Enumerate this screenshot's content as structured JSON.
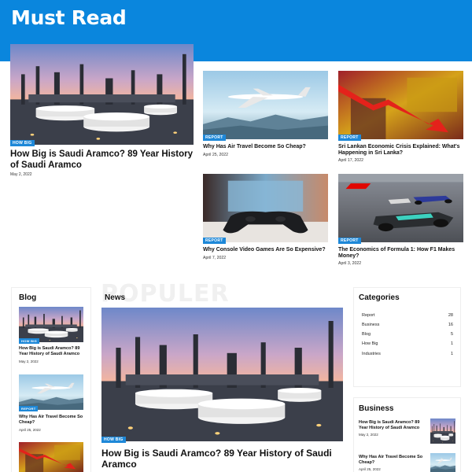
{
  "page_title": "Must Read",
  "featured": {
    "badge": "HOW BIG",
    "title": "How Big is Saudi Aramco? 89 Year History of Saudi Aramco",
    "date": "May 2, 2022"
  },
  "cards": [
    {
      "badge": "REPORT",
      "title": "Why Has Air Travel Become So Cheap?",
      "date": "April 25, 2022"
    },
    {
      "badge": "REPORT",
      "title": "Sri Lankan Economic Crisis Explained: What's Happening in Sri Lanka?",
      "date": "April 17, 2022"
    },
    {
      "badge": "REPORT",
      "title": "Why Console Video Games Are So Expensive?",
      "date": "April 7, 2022"
    },
    {
      "badge": "REPORT",
      "title": "The Economics of Formula 1: How F1 Makes Money?",
      "date": "April 3, 2022"
    }
  ],
  "blog": {
    "heading": "Blog",
    "items": [
      {
        "badge": "HOW BIG",
        "title": "How Big is Saudi Aramco? 89 Year History of Saudi Aramco",
        "date": "May 2, 2022"
      },
      {
        "badge": "REPORT",
        "title": "Why Has Air Travel Become So Cheap?",
        "date": "April 25, 2022"
      }
    ]
  },
  "news": {
    "watermark": "POPULER",
    "heading": "News",
    "badge": "HOW BIG",
    "title": "How Big is Saudi Aramco? 89 Year History of Saudi Aramco"
  },
  "categories": {
    "heading": "Categories",
    "items": [
      {
        "name": "Report",
        "count": "28"
      },
      {
        "name": "Business",
        "count": "16"
      },
      {
        "name": "Blog",
        "count": "5"
      },
      {
        "name": "How Big",
        "count": "1"
      },
      {
        "name": "Industries",
        "count": "1"
      }
    ]
  },
  "business": {
    "heading": "Business",
    "items": [
      {
        "title": "How Big is Saudi Aramco? 89 Year History of Saudi Aramco",
        "date": "May 2, 2022"
      },
      {
        "title": "Why Has Air Travel Become So Cheap?",
        "date": "April 25, 2022"
      }
    ]
  },
  "colors": {
    "header": "#0a86dd",
    "badge": "#1e88d8"
  }
}
